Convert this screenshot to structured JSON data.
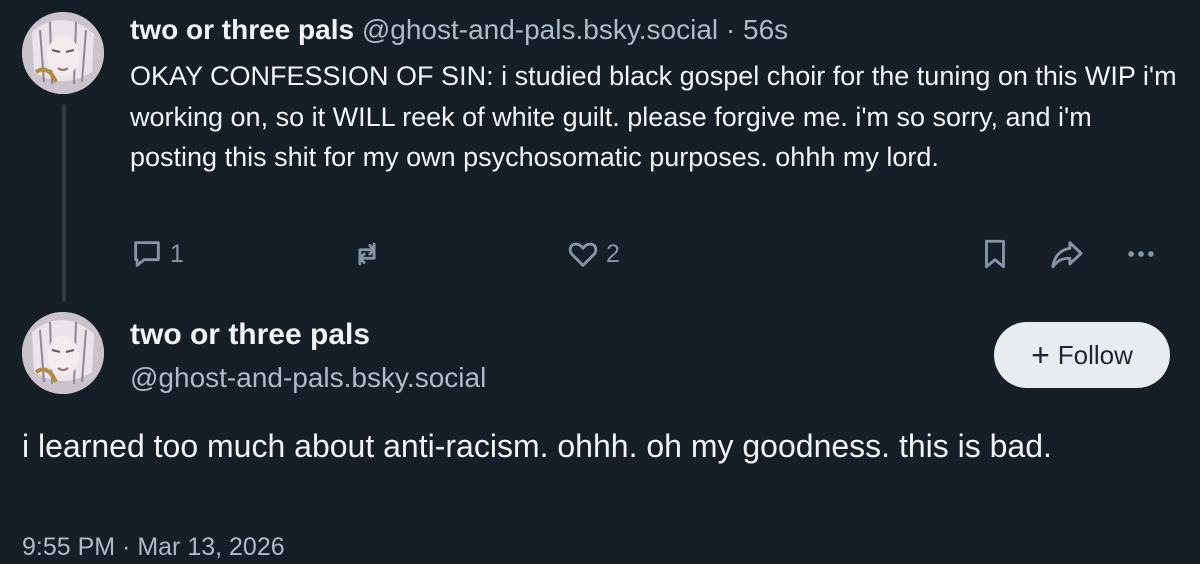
{
  "reply": {
    "author_name": "two or three pals",
    "author_handle": "@ghost-and-pals.bsky.social",
    "separator": "·",
    "age": "56s",
    "text": "OKAY CONFESSION OF SIN: i studied black gospel choir for the tuning on this WIP i'm working on, so it WILL reek of white guilt. please forgive me. i'm so sorry, and i'm posting this shit for my own psychosomatic purposes. ohhh my lord.",
    "reply_count": "1",
    "like_count": "2"
  },
  "post": {
    "author_name": "two or three pals",
    "author_handle": "@ghost-and-pals.bsky.social",
    "follow_label": "Follow",
    "follow_icon": "+",
    "text": "i learned too much about anti-racism. ohhh. oh my goodness. this is bad.",
    "timestamp": "9:55 PM · Mar 13, 2026"
  },
  "icons": {
    "reply": "speech-bubble-icon",
    "repost": "repost-arrows-icon",
    "like": "heart-icon",
    "bookmark": "bookmark-icon",
    "share": "share-arrow-icon",
    "more": "ellipsis-icon"
  },
  "colors": {
    "background": "#161e27",
    "text_primary": "#f1f3f5",
    "text_secondary": "#aebbc9",
    "icon": "#8796a7",
    "follow_button_bg": "#e8ecf1"
  }
}
